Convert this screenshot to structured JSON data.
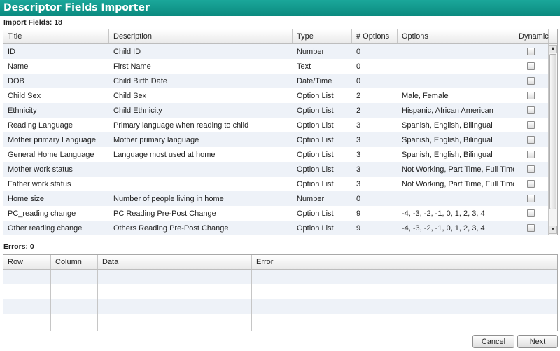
{
  "window": {
    "title": "Descriptor Fields Importer"
  },
  "import": {
    "label": "Import Fields: 18",
    "columns": [
      "Title",
      "Description",
      "Type",
      "# Options",
      "Options",
      "Dynamic"
    ],
    "rows": [
      {
        "title": "ID",
        "description": "Child ID",
        "type": "Number",
        "num_options": "0",
        "options": ""
      },
      {
        "title": "Name",
        "description": "First Name",
        "type": "Text",
        "num_options": "0",
        "options": ""
      },
      {
        "title": "DOB",
        "description": "Child Birth Date",
        "type": "Date/Time",
        "num_options": "0",
        "options": ""
      },
      {
        "title": "Child Sex",
        "description": "Child Sex",
        "type": "Option List",
        "num_options": "2",
        "options": "Male, Female"
      },
      {
        "title": "Ethnicity",
        "description": "Child Ethnicity",
        "type": "Option List",
        "num_options": "2",
        "options": "Hispanic, African American"
      },
      {
        "title": "Reading Language",
        "description": "Primary language when reading to child",
        "type": "Option List",
        "num_options": "3",
        "options": "Spanish, English, Bilingual"
      },
      {
        "title": "Mother primary Language",
        "description": "Mother primary language",
        "type": "Option List",
        "num_options": "3",
        "options": "Spanish, English, Bilingual"
      },
      {
        "title": "General Home Language",
        "description": "Language most used at home",
        "type": "Option List",
        "num_options": "3",
        "options": "Spanish, English, Bilingual"
      },
      {
        "title": "Mother work status",
        "description": "",
        "type": "Option List",
        "num_options": "3",
        "options": "Not Working, Part Time, Full Time"
      },
      {
        "title": "Father work status",
        "description": "",
        "type": "Option List",
        "num_options": "3",
        "options": "Not Working, Part Time, Full Time"
      },
      {
        "title": "Home size",
        "description": "Number of people living in home",
        "type": "Number",
        "num_options": "0",
        "options": ""
      },
      {
        "title": "PC_reading change",
        "description": "PC Reading Pre-Post Change",
        "type": "Option List",
        "num_options": "9",
        "options": "-4, -3, -2, -1, 0, 1, 2, 3, 4"
      },
      {
        "title": "Other reading change",
        "description": "Others Reading Pre-Post Change",
        "type": "Option List",
        "num_options": "9",
        "options": "-4, -3, -2, -1, 0, 1, 2, 3, 4"
      }
    ]
  },
  "errors": {
    "label": "Errors: 0",
    "columns": [
      "Row",
      "Column",
      "Data",
      "Error"
    ]
  },
  "buttons": {
    "cancel": "Cancel",
    "next": "Next"
  },
  "icons": {
    "scroll_up": "triangle-up-icon",
    "scroll_down": "triangle-down-icon"
  },
  "colors": {
    "titlebar": "#0b8a7f",
    "alt_row": "#eef2f8"
  }
}
